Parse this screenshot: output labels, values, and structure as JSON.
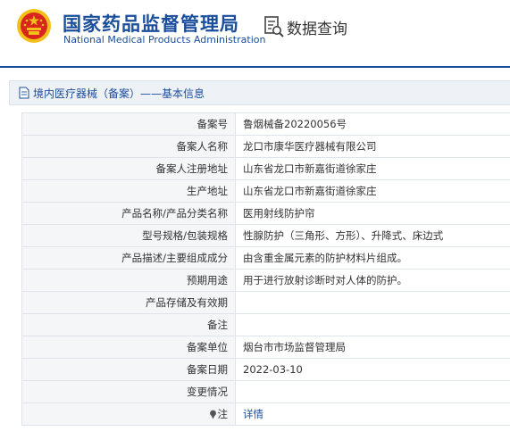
{
  "header": {
    "title_cn": "国家药品监督管理局",
    "title_en": "National Medical Products Administration",
    "query_label": "数据查询",
    "emblem_icon": "national-emblem-icon",
    "query_icon": "data-query-icon"
  },
  "section": {
    "title": "境内医疗器械（备案）——基本信息"
  },
  "rows": [
    {
      "label": "备案号",
      "value": "鲁烟械备20220056号"
    },
    {
      "label": "备案人名称",
      "value": "龙口市康华医疗器械有限公司"
    },
    {
      "label": "备案人注册地址",
      "value": "山东省龙口市新嘉街道徐家庄"
    },
    {
      "label": "生产地址",
      "value": "山东省龙口市新嘉街道徐家庄"
    },
    {
      "label": "产品名称/产品分类名称",
      "value": "医用射线防护帘"
    },
    {
      "label": "型号规格/包装规格",
      "value": "性腺防护（三角形、方形）、升降式、床边式"
    },
    {
      "label": "产品描述/主要组成成分",
      "value": "由含重金属元素的防护材料片组成。"
    },
    {
      "label": "预期用途",
      "value": "用于进行放射诊断时对人体的防护。"
    },
    {
      "label": "产品存储及有效期",
      "value": ""
    },
    {
      "label": "备注",
      "value": ""
    },
    {
      "label": "备案单位",
      "value": "烟台市市场监督管理局"
    },
    {
      "label": "备案日期",
      "value": "2022-03-10"
    },
    {
      "label": "变更情况",
      "value": ""
    }
  ],
  "note_row": {
    "label": "注",
    "link": "详情",
    "icon": "note-pin-icon"
  },
  "colors": {
    "brand_blue": "#1a4d9c",
    "emblem_red": "#d9261c",
    "emblem_gold": "#f3c01a",
    "label_bg": "#f5f6f8",
    "border": "#dfe3ea"
  }
}
